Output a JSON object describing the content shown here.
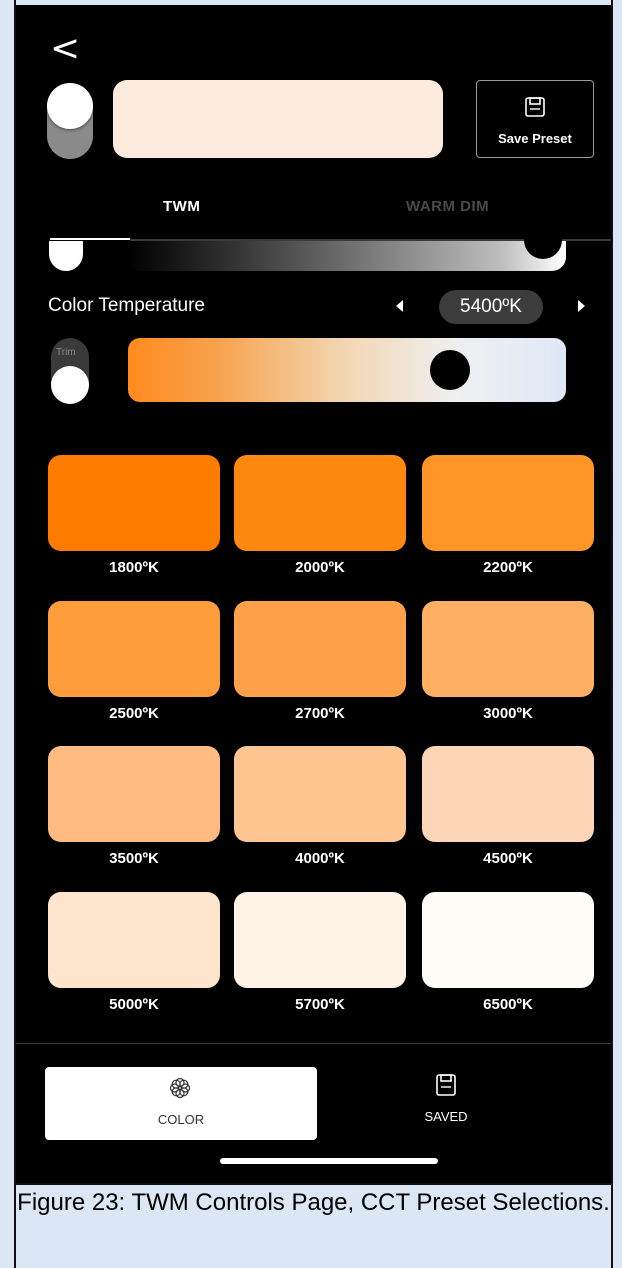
{
  "header": {
    "back_glyph": "<",
    "save_preset_label": "Save Preset",
    "preview_color": "#fcebdc"
  },
  "tabs": {
    "twm": "TWM",
    "warm_dim": "WARM DIM"
  },
  "color_temperature": {
    "label": "Color Temperature",
    "value": "5400ºK",
    "trim_label": "Trim"
  },
  "presets": [
    {
      "label": "1800ºK",
      "color": "#ff7c00"
    },
    {
      "label": "2000ºK",
      "color": "#ff8810"
    },
    {
      "label": "2200ºK",
      "color": "#ff9427"
    },
    {
      "label": "2500ºK",
      "color": "#ff9d3c"
    },
    {
      "label": "2700ºK",
      "color": "#ffa14a"
    },
    {
      "label": "3000ºK",
      "color": "#ffaf63"
    },
    {
      "label": "3500ºK",
      "color": "#ffbb80"
    },
    {
      "label": "4000ºK",
      "color": "#ffc591"
    },
    {
      "label": "4500ºK",
      "color": "#fcd4b6"
    },
    {
      "label": "5000ºK",
      "color": "#fde4cd"
    },
    {
      "label": "5700ºK",
      "color": "#fff2e6"
    },
    {
      "label": "6500ºK",
      "color": "#fffbf6"
    }
  ],
  "bottom_nav": {
    "color": "COLOR",
    "saved": "SAVED"
  },
  "caption": "Figure 23: TWM Controls Page, CCT Preset Selections."
}
